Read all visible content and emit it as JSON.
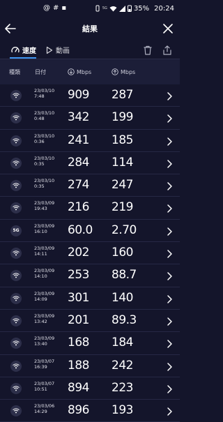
{
  "status_bar": {
    "left_icons": [
      "at-sign-icon",
      "hash-icon",
      "notification-dot-icon"
    ],
    "tiny_text": "5G",
    "battery": "35%",
    "time": "20:24"
  },
  "header": {
    "title": "結果"
  },
  "tabs": [
    {
      "label": "速度",
      "icon": "gauge-icon",
      "active": true
    },
    {
      "label": "動画",
      "icon": "play-icon",
      "active": false
    }
  ],
  "columns": {
    "type": "種類",
    "date": "日付",
    "download": "Mbps",
    "upload": "Mbps"
  },
  "rows": [
    {
      "icon": "wifi",
      "date": "23/03/10",
      "time": "7:48",
      "down": "909",
      "up": "287"
    },
    {
      "icon": "wifi",
      "date": "23/03/10",
      "time": "0:48",
      "down": "342",
      "up": "199"
    },
    {
      "icon": "wifi",
      "date": "23/03/10",
      "time": "0:36",
      "down": "241",
      "up": "185"
    },
    {
      "icon": "wifi",
      "date": "23/03/10",
      "time": "0:35",
      "down": "284",
      "up": "114"
    },
    {
      "icon": "wifi",
      "date": "23/03/10",
      "time": "0:35",
      "down": "274",
      "up": "247"
    },
    {
      "icon": "wifi",
      "date": "23/03/09",
      "time": "19:43",
      "down": "216",
      "up": "219"
    },
    {
      "icon": "5G",
      "date": "23/03/09",
      "time": "16:10",
      "down": "60.0",
      "up": "2.70"
    },
    {
      "icon": "wifi",
      "date": "23/03/09",
      "time": "14:11",
      "down": "202",
      "up": "160"
    },
    {
      "icon": "wifi",
      "date": "23/03/09",
      "time": "14:10",
      "down": "253",
      "up": "88.7"
    },
    {
      "icon": "wifi",
      "date": "23/03/09",
      "time": "14:09",
      "down": "301",
      "up": "140"
    },
    {
      "icon": "wifi",
      "date": "23/03/09",
      "time": "13:42",
      "down": "201",
      "up": "89.3"
    },
    {
      "icon": "wifi",
      "date": "23/03/09",
      "time": "13:40",
      "down": "168",
      "up": "184"
    },
    {
      "icon": "wifi",
      "date": "23/03/07",
      "time": "16:39",
      "down": "188",
      "up": "242"
    },
    {
      "icon": "wifi",
      "date": "23/03/07",
      "time": "10:51",
      "down": "894",
      "up": "223"
    },
    {
      "icon": "wifi",
      "date": "23/03/06",
      "time": "14:29",
      "down": "896",
      "up": "193"
    }
  ],
  "colors": {
    "background": "#14152b",
    "header_row": "#1c1e38",
    "accent": "#3e95f0"
  }
}
